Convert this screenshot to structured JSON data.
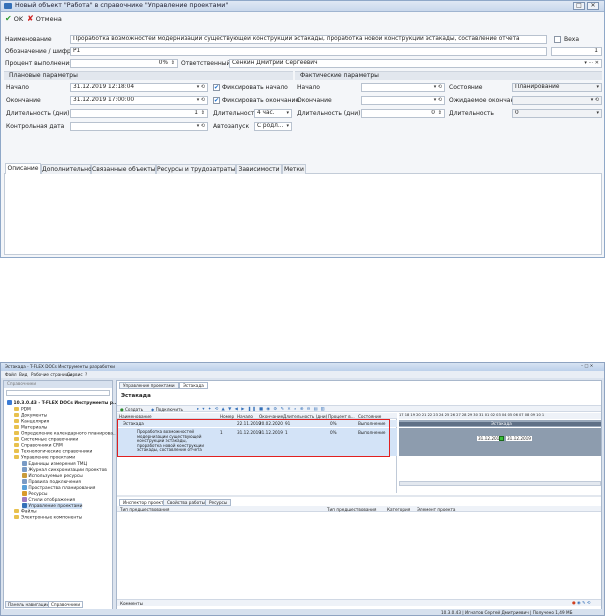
{
  "dialog": {
    "title": "Новый объект \"Работа\" в справочнике \"Управление проектами\"",
    "toolbar": {
      "ok": "OK",
      "cancel": "Отмена"
    },
    "name_label": "Наименование",
    "name_value": "Проработка возможностей модернизации существующей конструкции эстакады, проработка новой конструкции эстакады, составление отчета",
    "weight_label": "Веха",
    "code_label": "Обозначение / шифр",
    "code_value": "P1",
    "code_num": "1",
    "percent_label": "Процент выполнения",
    "percent_value": "0%",
    "responsible_label": "Ответственный",
    "responsible_value": "Сенкин Дмитрий Сергеевич",
    "planned_header": "Плановые параметры",
    "actual_header": "Фактические параметры",
    "start_label": "Начало",
    "start_value": "31.12.2019 12:18:04",
    "fix_start": "Фиксировать начало",
    "end_label": "Окончание",
    "end_value": "31.12.2019 17:00:00",
    "fix_end": "Фиксировать окончание",
    "duration_label": "Длительность (дни)",
    "duration_value": "1",
    "duration2_label": "Длительность",
    "duration2_value": "4 час.",
    "control_label": "Контрольная дата",
    "autostart_label": "Автозапуск",
    "autostart_value": "С родл...",
    "a_start_label": "Начало",
    "a_end_label": "Окончание",
    "a_duration_label": "Длительность (дни)",
    "a_duration_value": "0",
    "state_label": "Состояние",
    "state_value": "Планирование",
    "expected_end_label": "Ожидаемое окончание",
    "a_duration2_label": "Длительность",
    "a_duration2_value": "0",
    "tabs": [
      "Описание",
      "Дополнительно",
      "Связанные объекты",
      "Ресурсы и трудозатраты",
      "Зависимости",
      "Метки"
    ]
  },
  "app": {
    "title": "Эстакада - T-FLEX DOCs Инструменты разработки",
    "menu": [
      "Файл",
      "Вид",
      "Рабочие страницы",
      "Сервис",
      "?"
    ],
    "nav_header": "Справочники",
    "tree_root": "10.3.0.43 - T-FLEX DOCs Инструменты р...",
    "tree": [
      "PDM",
      "Документы",
      "Канцелярия",
      "Материалы",
      "Определение календарного планирова...",
      "Системные справочники",
      "Справочники CRM",
      "Технологические справочники",
      "Управление проектами",
      "Единицы измерения ТМЦ",
      "Журнал синхронизации проектов",
      "Используемые ресурсы",
      "Правила подключения",
      "Пространства планирования",
      "Ресурсы",
      "Стили отображения",
      "Управление проектами",
      "Файлы",
      "Электронные компоненты"
    ],
    "doc_tabs": [
      "Управление проектами",
      "Эстакада"
    ],
    "page_title": "Эстакада",
    "create_btn": "Создать",
    "connections_btn": "Подключить",
    "columns": [
      "Наименование",
      "Номер",
      "Начало",
      "Окончание",
      "Длительность (дни)",
      "Процент в...",
      "Состояние"
    ],
    "rows": [
      {
        "name": "Эстакада",
        "num": "",
        "start": "22.11.2019",
        "end": "20.02.2020",
        "dur": "91",
        "pct": "0%",
        "state": "Выполнение"
      },
      {
        "name": "Проработка возможностей модернизации существующей конструкции эстакады, проработка новой конструкции эстакады, составление отчета",
        "num": "1",
        "start": "31.12.2019",
        "end": "31.12.2019",
        "dur": "1",
        "pct": "0%",
        "state": "Выполнение"
      }
    ],
    "gantt_dates": "17 18 19 20 21 22 23 24 25 26 27 28 29 30 31 01 02 03 04 05 06 07 08 09 10 1",
    "gantt_bar_label": "Эстакада",
    "gantt_date1": "31.12.2019",
    "gantt_date2": "31.12.2019",
    "bottom_tabs": [
      "Инспектор проекта",
      "Свойства работы",
      "Ресурсы"
    ],
    "bottom_cols": [
      "Тип предшествования",
      "Тип предшествования",
      "Категория",
      "Элемент проекта"
    ],
    "comments_label": "Комменты",
    "nav_footer": [
      "Панель навигации",
      "Справочники"
    ],
    "status": "10.3.0.43 | Игнатов Сергей Дмитриевич | Получено 1,49 МБ"
  },
  "colors": {
    "accent": "#3470b8",
    "highlight": "#e02020",
    "title_bar": "#c9d8ec"
  }
}
